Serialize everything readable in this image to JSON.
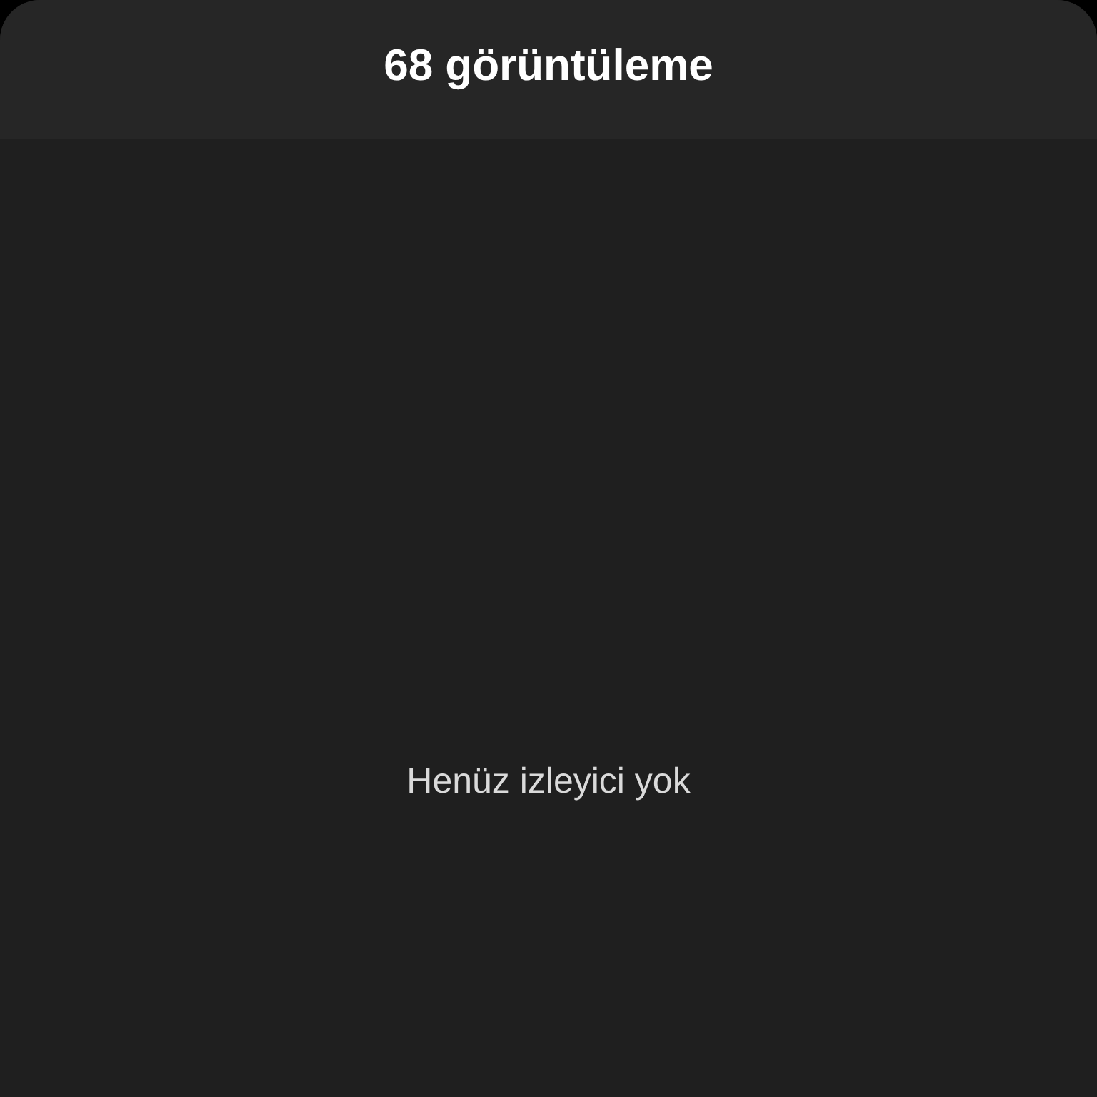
{
  "header": {
    "title": "68 görüntüleme"
  },
  "viewers": {
    "empty_message": "Henüz izleyici yok"
  }
}
